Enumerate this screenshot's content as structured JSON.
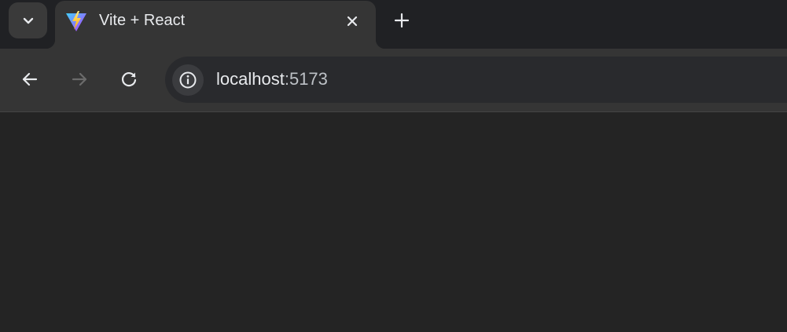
{
  "tab": {
    "title": "Vite + React",
    "favicon": "vite-logo-icon"
  },
  "address_bar": {
    "host": "localhost",
    "port": ":5173"
  },
  "icons": {
    "tab_search": "chevron-down-icon",
    "tab_close": "close-icon",
    "new_tab": "plus-icon",
    "back": "arrow-left-icon",
    "forward": "arrow-right-icon",
    "reload": "reload-icon",
    "site_info": "info-icon"
  },
  "colors": {
    "page_background": "#242424",
    "titlebar": "#202124",
    "toolbar": "#353535",
    "omnibox": "#292a2d",
    "forward_disabled": "#6b6b6b"
  },
  "state": {
    "forward_enabled": false
  }
}
